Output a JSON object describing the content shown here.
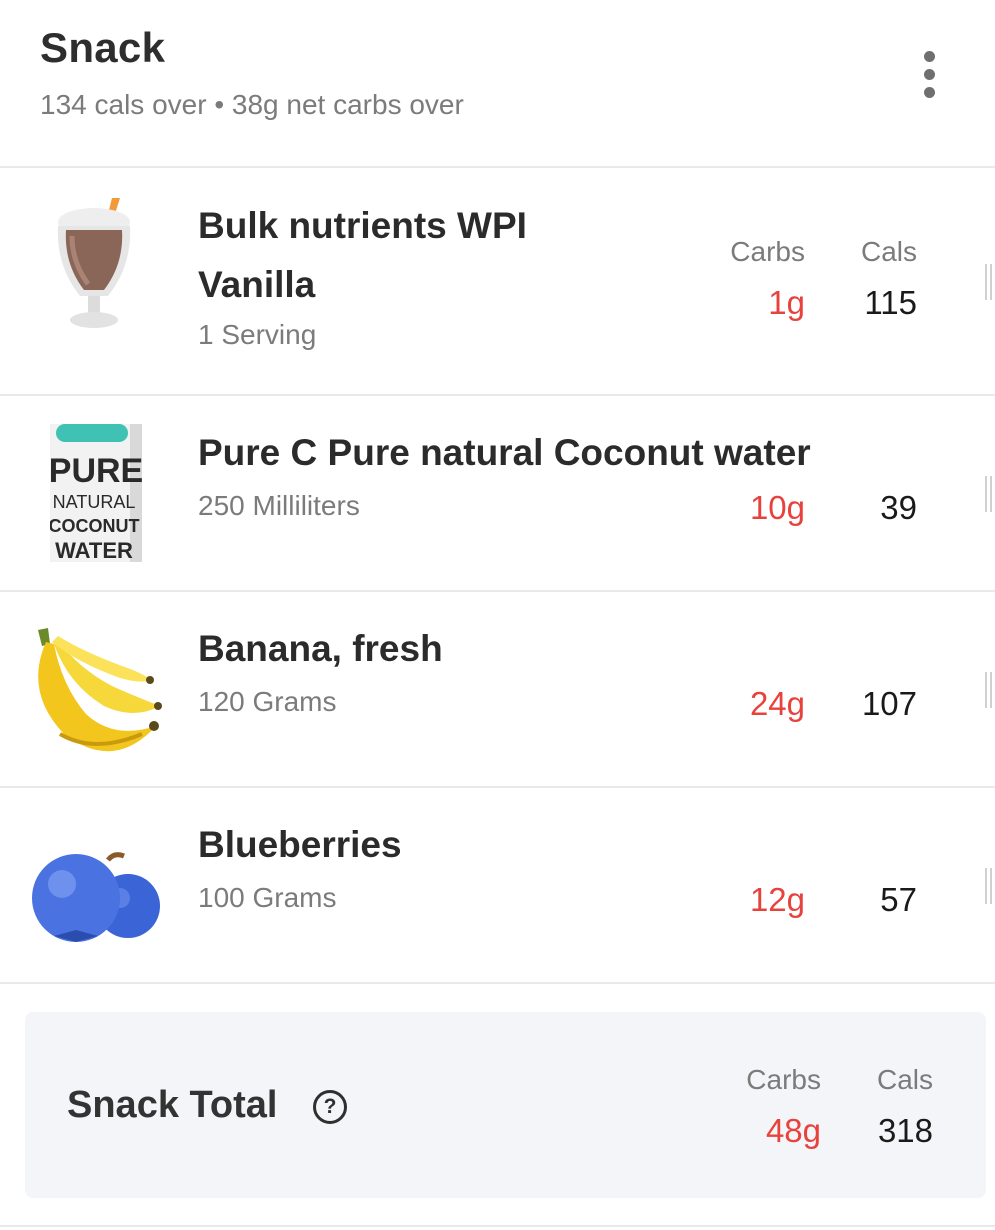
{
  "meal": {
    "title": "Snack",
    "summary": "134 cals over • 38g net carbs over"
  },
  "columns": {
    "carbs_label": "Carbs",
    "cals_label": "Cals"
  },
  "items": [
    {
      "name": "Bulk nutrients WPI Vanilla",
      "name_line1": "Bulk nutrients WPI",
      "name_line2": "Vanilla",
      "quantity": "1 Serving",
      "carbs": "1g",
      "cals": "115",
      "icon": "milkshake-icon"
    },
    {
      "name": "Pure C Pure natural Coconut water",
      "quantity": "250 Milliliters",
      "carbs": "10g",
      "cals": "39",
      "icon": "coconut-water-carton-icon",
      "carton_text": [
        "PURE",
        "NATURAL",
        "COCONUT",
        "WATER"
      ]
    },
    {
      "name": "Banana, fresh",
      "quantity": "120 Grams",
      "carbs": "24g",
      "cals": "107",
      "icon": "banana-icon"
    },
    {
      "name": "Blueberries",
      "quantity": "100 Grams",
      "carbs": "12g",
      "cals": "57",
      "icon": "blueberries-icon"
    }
  ],
  "total": {
    "label": "Snack Total",
    "carbs": "48g",
    "cals": "318",
    "help_glyph": "?"
  },
  "colors": {
    "carbs": "#e8423d",
    "text": "#2b2b2b",
    "muted": "#7b7b7b",
    "total_bg": "#f3f5f8"
  }
}
